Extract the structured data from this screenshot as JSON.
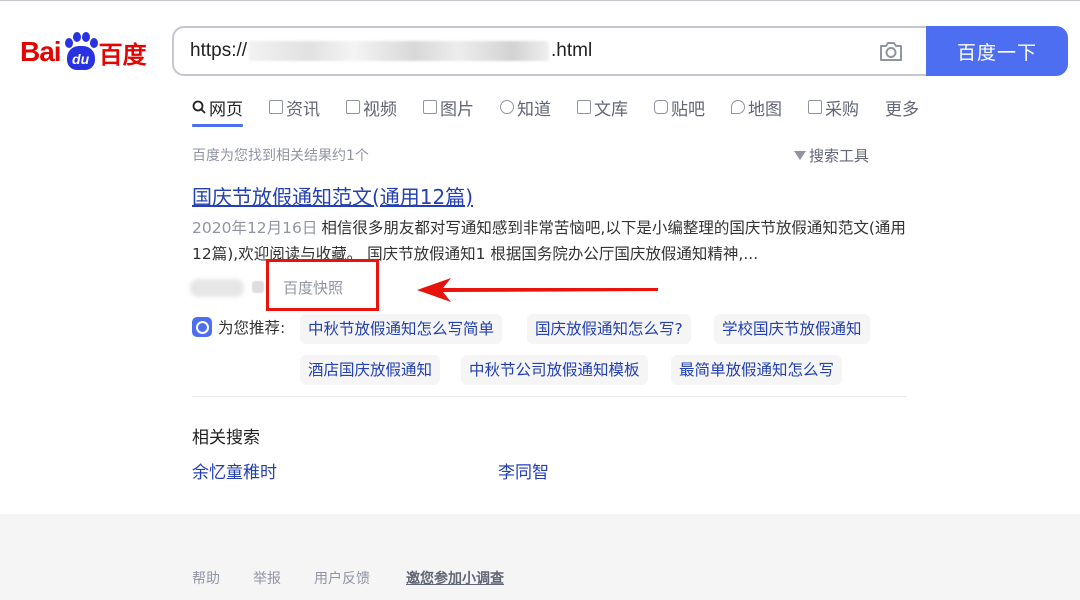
{
  "logo": {
    "text_latin": "Bai",
    "text_paw": "du",
    "text_cn": "百度"
  },
  "search": {
    "prefix": "https://",
    "suffix": ".html",
    "button_label": "百度一下"
  },
  "tabs": [
    {
      "label": "网页",
      "icon": "search-icon"
    },
    {
      "label": "资讯",
      "icon": "news-icon"
    },
    {
      "label": "视频",
      "icon": "video-icon"
    },
    {
      "label": "图片",
      "icon": "image-icon"
    },
    {
      "label": "知道",
      "icon": "question-icon"
    },
    {
      "label": "文库",
      "icon": "document-icon"
    },
    {
      "label": "贴吧",
      "icon": "tieba-icon"
    },
    {
      "label": "地图",
      "icon": "map-icon"
    },
    {
      "label": "采购",
      "icon": "cart-icon"
    },
    {
      "label": "更多",
      "icon": ""
    }
  ],
  "results_meta": {
    "count_text": "百度为您找到相关结果约1个",
    "tools_label": "搜索工具"
  },
  "result": {
    "title": "国庆节放假通知范文(通用12篇)",
    "date": "2020年12月16日",
    "snippet": "相信很多朋友都对写通知感到非常苦恼吧,以下是小编整理的国庆节放假通知范文(通用12篇),欢迎阅读与收藏。 国庆节放假通知1 根据国务院办公厅国庆放假通知精神,...",
    "snapshot_label": "百度快照"
  },
  "recommend": {
    "label": "为您推荐:",
    "items": [
      "中秋节放假通知怎么写简单",
      "国庆放假通知怎么写?",
      "学校国庆节放假通知",
      "酒店国庆放假通知",
      "中秋节公司放假通知模板",
      "最简单放假通知怎么写"
    ]
  },
  "related": {
    "title": "相关搜索",
    "items": [
      "余忆童稚时",
      "李同智"
    ]
  },
  "footer": {
    "links": [
      "帮助",
      "举报",
      "用户反馈",
      "邀您参加小调查"
    ]
  },
  "colors": {
    "brand_blue": "#4e6ef2",
    "link_blue": "#2440b3",
    "logo_red": "#e10601",
    "annotation_red": "#e8140c"
  }
}
